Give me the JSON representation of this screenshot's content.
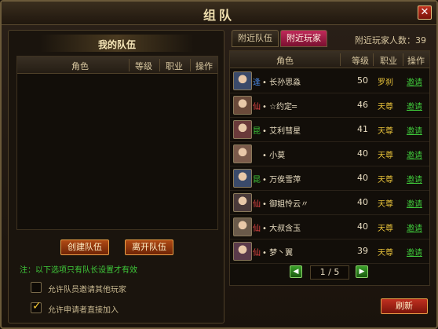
{
  "window": {
    "title": "组队",
    "close_label": "✕"
  },
  "my_team": {
    "title": "我的队伍",
    "columns": [
      "角色",
      "等级",
      "职业",
      "操作"
    ],
    "create_button": "创建队伍",
    "leave_button": "离开队伍",
    "note": "注：以下选项只有队长设置才有效",
    "options": [
      {
        "label": "允许队员邀请其他玩家",
        "checked": false
      },
      {
        "label": "允许申请者直接加入",
        "checked": true
      }
    ]
  },
  "nearby": {
    "tabs": [
      {
        "label": "附近队伍",
        "active": false
      },
      {
        "label": "附近玩家",
        "active": true
      }
    ],
    "player_count_label": "附近玩家人数：39",
    "columns": [
      "角色",
      "等级",
      "职业",
      "操作"
    ],
    "players": [
      {
        "class_tag": "逢",
        "tag_color": "#4a8ae8",
        "name": "• 长孙思淼",
        "level": "50",
        "profession": "罗刹",
        "action": "邀请",
        "avatar_color": "#3a4a6a"
      },
      {
        "class_tag": "仙",
        "tag_color": "#e84848",
        "name": "• ☆约定═",
        "level": "46",
        "profession": "天尊",
        "action": "邀请",
        "avatar_color": "#6a4a3a"
      },
      {
        "class_tag": "昆",
        "tag_color": "#3fc93a",
        "name": "• 艾利彗星",
        "level": "41",
        "profession": "天尊",
        "action": "邀请",
        "avatar_color": "#6a3a3a"
      },
      {
        "class_tag": "",
        "tag_color": "#e8dcc0",
        "name": "• 小莫",
        "level": "40",
        "profession": "天尊",
        "action": "邀请",
        "avatar_color": "#7a5a4a"
      },
      {
        "class_tag": "昆",
        "tag_color": "#3fc93a",
        "name": "• 万俟雪萍",
        "level": "40",
        "profession": "天尊",
        "action": "邀请",
        "avatar_color": "#3a4a6a"
      },
      {
        "class_tag": "仙",
        "tag_color": "#e84848",
        "name": "• 御姐怜云〃",
        "level": "40",
        "profession": "天尊",
        "action": "邀请",
        "avatar_color": "#4a3a3a"
      },
      {
        "class_tag": "仙",
        "tag_color": "#e84848",
        "name": "• 大叔含玉",
        "level": "40",
        "profession": "天尊",
        "action": "邀请",
        "avatar_color": "#6a5a4a"
      },
      {
        "class_tag": "仙",
        "tag_color": "#e84848",
        "name": "• 梦丶翼",
        "level": "39",
        "profession": "天尊",
        "action": "邀请",
        "avatar_color": "#5a3a4a"
      }
    ],
    "pager": {
      "prev": "◀",
      "page": "1 / 5",
      "next": "▶"
    },
    "refresh_button": "刷新"
  }
}
